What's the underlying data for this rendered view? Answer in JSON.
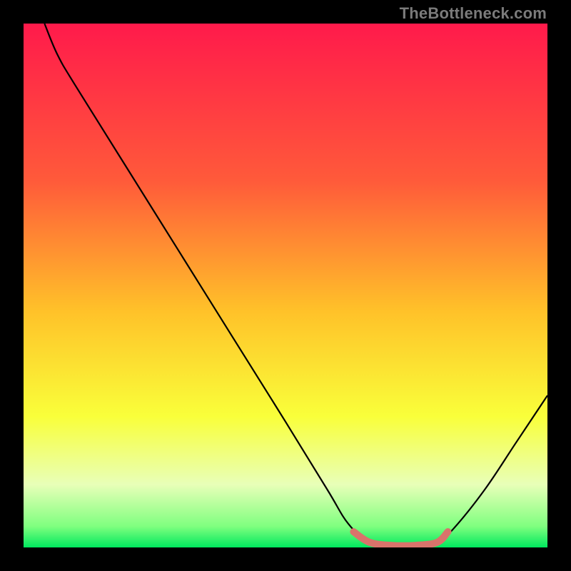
{
  "watermark": "TheBottleneck.com",
  "chart_data": {
    "type": "line",
    "title": "",
    "xlabel": "",
    "ylabel": "",
    "xlim": [
      0,
      100
    ],
    "ylim": [
      0,
      100
    ],
    "gradient_stops": [
      {
        "offset": 0,
        "color": "#ff1a4b"
      },
      {
        "offset": 30,
        "color": "#ff5a3a"
      },
      {
        "offset": 55,
        "color": "#ffc229"
      },
      {
        "offset": 75,
        "color": "#f9ff3a"
      },
      {
        "offset": 88,
        "color": "#e8ffb8"
      },
      {
        "offset": 96,
        "color": "#7fff7f"
      },
      {
        "offset": 100,
        "color": "#00e85e"
      }
    ],
    "series": [
      {
        "name": "bottleneck-curve",
        "color": "#000000",
        "points": [
          {
            "x": 4.0,
            "y": 100.0
          },
          {
            "x": 6.5,
            "y": 94.0
          },
          {
            "x": 10.0,
            "y": 88.0
          },
          {
            "x": 20.0,
            "y": 72.0
          },
          {
            "x": 30.0,
            "y": 56.0
          },
          {
            "x": 40.0,
            "y": 40.0
          },
          {
            "x": 50.0,
            "y": 24.0
          },
          {
            "x": 58.0,
            "y": 11.0
          },
          {
            "x": 62.0,
            "y": 4.5
          },
          {
            "x": 66.0,
            "y": 1.0
          },
          {
            "x": 70.0,
            "y": 0.3
          },
          {
            "x": 75.0,
            "y": 0.3
          },
          {
            "x": 79.0,
            "y": 1.0
          },
          {
            "x": 82.0,
            "y": 3.5
          },
          {
            "x": 88.0,
            "y": 11.0
          },
          {
            "x": 94.0,
            "y": 20.0
          },
          {
            "x": 100.0,
            "y": 29.0
          }
        ]
      },
      {
        "name": "bottleneck-highlight",
        "color": "#d9736b",
        "points": [
          {
            "x": 63.0,
            "y": 3.0
          },
          {
            "x": 66.0,
            "y": 1.0
          },
          {
            "x": 70.0,
            "y": 0.4
          },
          {
            "x": 75.0,
            "y": 0.4
          },
          {
            "x": 79.0,
            "y": 1.0
          },
          {
            "x": 81.0,
            "y": 3.0
          }
        ]
      }
    ]
  }
}
